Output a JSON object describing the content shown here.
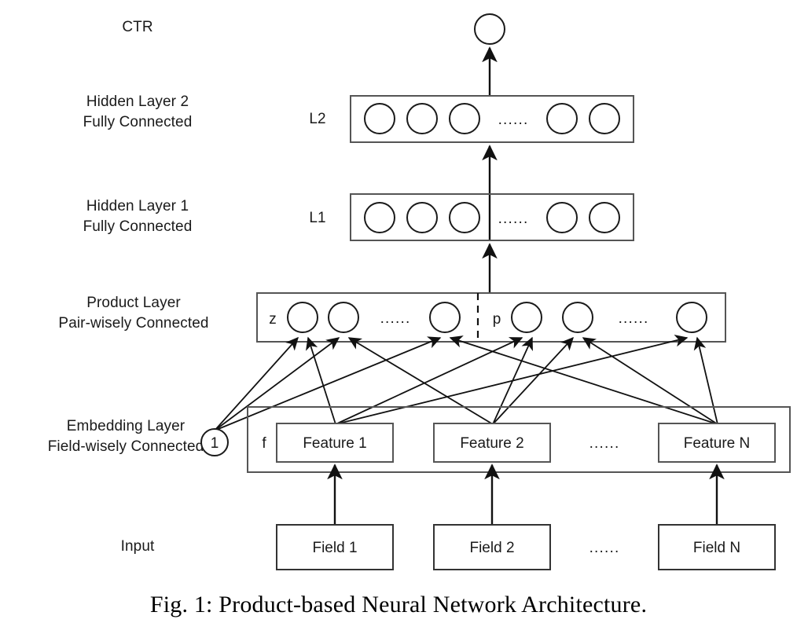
{
  "figure": {
    "caption": "Fig. 1: Product-based Neural Network Architecture."
  },
  "row_labels": {
    "ctr": "CTR",
    "hidden2": "Hidden Layer 2\nFully Connected",
    "hidden1": "Hidden Layer 1\nFully Connected",
    "product": "Product Layer\nPair-wisely Connected",
    "embedding": "Embedding Layer\nField-wisely Connected",
    "input": "Input"
  },
  "layers": {
    "output": {
      "name": "CTR output node",
      "node_count": 1
    },
    "l2": {
      "tag": "L2",
      "node_count": 5,
      "ellipsis": "......"
    },
    "l1": {
      "tag": "L1",
      "node_count": 5,
      "ellipsis": "......"
    },
    "product": {
      "z_tag": "z",
      "p_tag": "p",
      "z_node_count": 3,
      "p_node_count": 3,
      "z_ellipsis": "......",
      "p_ellipsis": "......",
      "divider": "dashed"
    },
    "embedding": {
      "bias_node": "1",
      "f_tag": "f",
      "ellipsis": "......",
      "features": [
        "Feature 1",
        "Feature 2",
        "Feature N"
      ]
    },
    "input": {
      "ellipsis": "......",
      "fields": [
        "Field 1",
        "Field 2",
        "Field N"
      ]
    }
  },
  "colors": {
    "stroke": "#1a1a1a",
    "box_stroke": "#555555",
    "background": "#ffffff",
    "text": "#1a1a1a"
  }
}
